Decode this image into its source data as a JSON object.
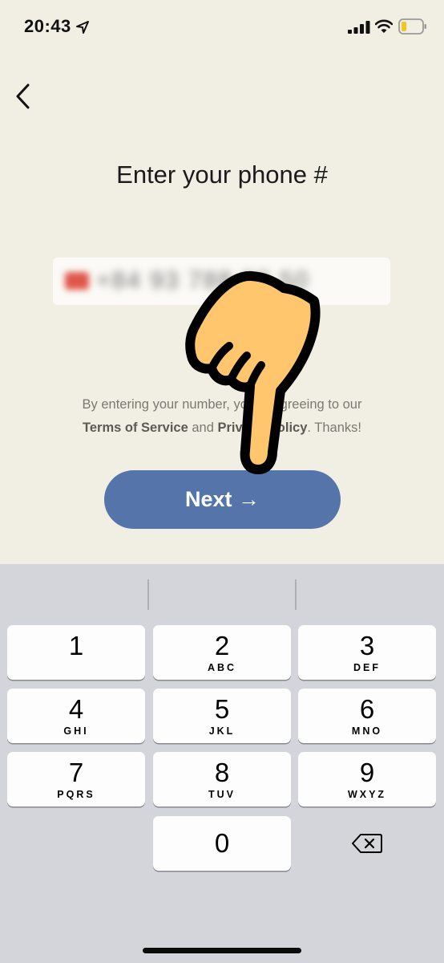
{
  "status_bar": {
    "time": "20:43"
  },
  "header": {
    "title": "Enter your phone #"
  },
  "phone_input": {
    "value": "+84 93 788 93 50"
  },
  "terms": {
    "prefix": "By entering your number, you're agreeing to our",
    "terms_link": "Terms of Service",
    "middle": "and",
    "privacy_link": "Privacy Policy",
    "suffix": ". Thanks!"
  },
  "next_button": {
    "label": "Next →"
  },
  "keypad": {
    "keys": [
      {
        "digit": "1",
        "letters": ""
      },
      {
        "digit": "2",
        "letters": "ABC"
      },
      {
        "digit": "3",
        "letters": "DEF"
      },
      {
        "digit": "4",
        "letters": "GHI"
      },
      {
        "digit": "5",
        "letters": "JKL"
      },
      {
        "digit": "6",
        "letters": "MNO"
      },
      {
        "digit": "7",
        "letters": "PQRS"
      },
      {
        "digit": "8",
        "letters": "TUV"
      },
      {
        "digit": "9",
        "letters": "WXYZ"
      },
      {
        "digit": "0",
        "letters": ""
      }
    ]
  },
  "icons": {
    "back": "chevron-left-icon",
    "location": "location-arrow-icon",
    "signal": "cellular-signal-icon",
    "wifi": "wifi-icon",
    "battery": "battery-low-icon",
    "delete": "backspace-icon",
    "hand": "pointing-hand-icon"
  },
  "colors": {
    "background": "#f1eee3",
    "accent": "#5574a9",
    "keyboard": "#d3d5db",
    "battery_level": "#f2c81f",
    "hand": "#ffc66e"
  }
}
